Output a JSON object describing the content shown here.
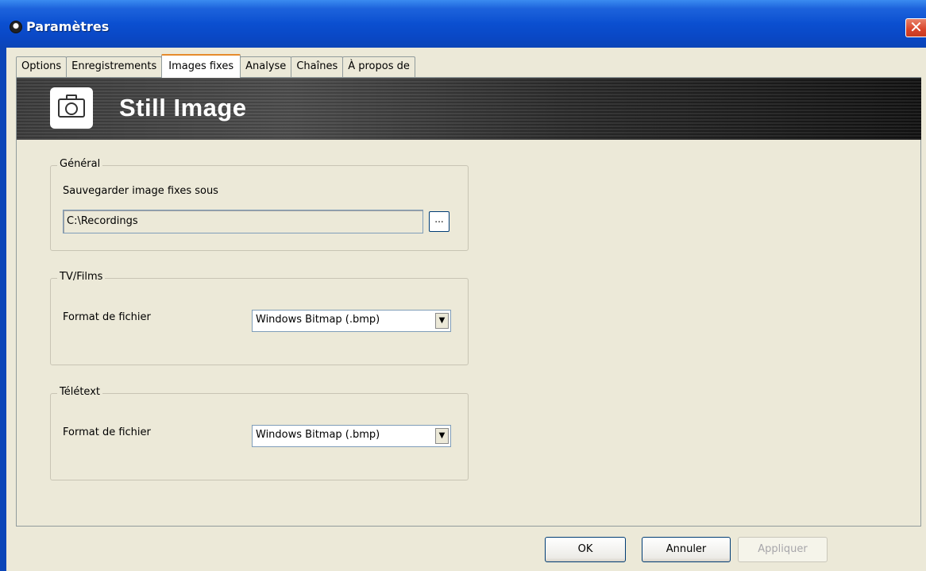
{
  "window": {
    "title": "Paramètres",
    "close_glyph": "✕"
  },
  "tabs": [
    {
      "label": "Options"
    },
    {
      "label": "Enregistrements"
    },
    {
      "label": "Images fixes"
    },
    {
      "label": "Analyse"
    },
    {
      "label": "Chaînes"
    },
    {
      "label": "À propos de"
    }
  ],
  "active_tab": "Images fixes",
  "banner": {
    "title": "Still Image",
    "icon": "camera-icon"
  },
  "general": {
    "title": "Général",
    "save_label": "Sauvegarder image fixes sous",
    "path_value": "C:\\Recordings",
    "browse_label": "..."
  },
  "tv_films": {
    "title": "TV/Films",
    "format_label": "Format de fichier",
    "format_value": "Windows Bitmap (.bmp)"
  },
  "teletext": {
    "title": "Télétext",
    "format_label": "Format de fichier",
    "format_value": "Windows Bitmap (.bmp)"
  },
  "buttons": {
    "ok": "OK",
    "cancel": "Annuler",
    "apply": "Appliquer"
  },
  "colors": {
    "titlebar": "#0b4fd0",
    "active_tab_accent": "#e68b2c",
    "dialog_bg": "#ece9d8"
  }
}
